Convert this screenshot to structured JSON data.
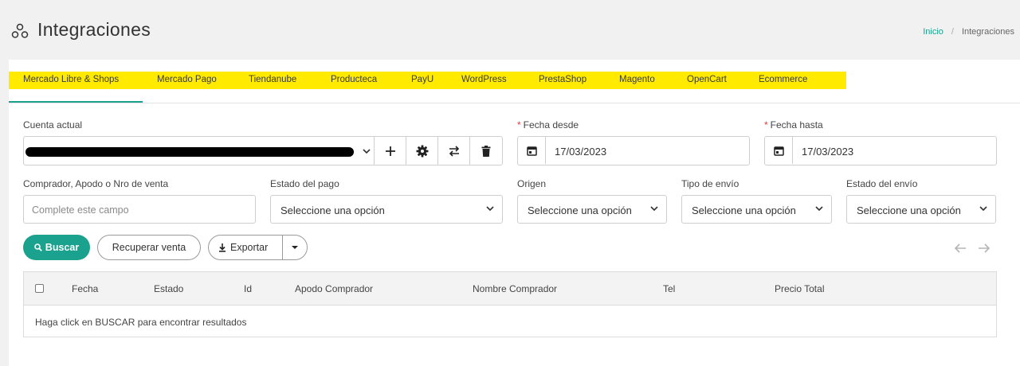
{
  "header": {
    "title": "Integraciones",
    "logo_icon": "nodes-icon",
    "breadcrumb": {
      "home": "Inicio",
      "separator": "/",
      "current": "Integraciones"
    }
  },
  "tabs": [
    {
      "label": "Mercado Libre & Shops",
      "active": true
    },
    {
      "label": "Mercado Pago"
    },
    {
      "label": "Tiendanube"
    },
    {
      "label": "Producteca"
    },
    {
      "label": "PayU"
    },
    {
      "label": "WordPress"
    },
    {
      "label": "PrestaShop"
    },
    {
      "label": "Magento"
    },
    {
      "label": "OpenCart"
    },
    {
      "label": "Ecommerce"
    }
  ],
  "colors": {
    "accent": "#1aa28f",
    "tab_highlight": "#ffea00",
    "required": "#e23a3a"
  },
  "filters": {
    "account_label": "Cuenta actual",
    "date_from_label": "Fecha desde",
    "date_from_value": "17/03/2023",
    "date_to_label": "Fecha hasta",
    "date_to_value": "17/03/2023",
    "required_mark": "*",
    "buyer_label": "Comprador, Apodo o Nro de venta",
    "buyer_placeholder": "Complete este campo",
    "payment_status_label": "Estado del pago",
    "payment_status_value": "Seleccione una opción",
    "origin_label": "Origen",
    "origin_value": "Seleccione una opción",
    "shipping_type_label": "Tipo de envío",
    "shipping_type_value": "Seleccione una opción",
    "shipping_status_label": "Estado del envío",
    "shipping_status_value": "Seleccione una opción"
  },
  "actions": {
    "search": "Buscar",
    "recover": "Recuperar venta",
    "export": "Exportar"
  },
  "table": {
    "columns": [
      "Fecha",
      "Estado",
      "Id",
      "Apodo Comprador",
      "Nombre Comprador",
      "Tel",
      "Precio Total"
    ],
    "empty_message": "Haga click en BUSCAR para encontrar resultados"
  }
}
